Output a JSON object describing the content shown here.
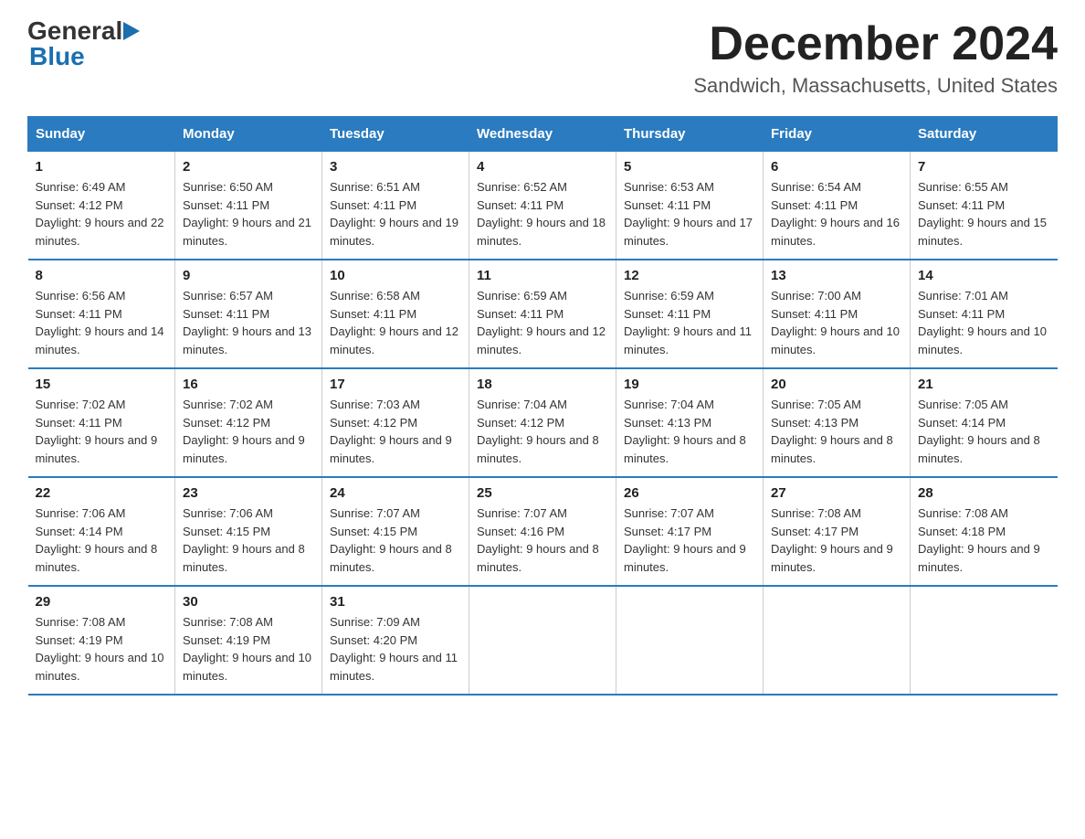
{
  "header": {
    "month_title": "December 2024",
    "location": "Sandwich, Massachusetts, United States"
  },
  "logo": {
    "general": "General",
    "blue": "Blue"
  },
  "days_of_week": [
    "Sunday",
    "Monday",
    "Tuesday",
    "Wednesday",
    "Thursday",
    "Friday",
    "Saturday"
  ],
  "weeks": [
    [
      {
        "day": "1",
        "sunrise": "6:49 AM",
        "sunset": "4:12 PM",
        "daylight": "9 hours and 22 minutes."
      },
      {
        "day": "2",
        "sunrise": "6:50 AM",
        "sunset": "4:11 PM",
        "daylight": "9 hours and 21 minutes."
      },
      {
        "day": "3",
        "sunrise": "6:51 AM",
        "sunset": "4:11 PM",
        "daylight": "9 hours and 19 minutes."
      },
      {
        "day": "4",
        "sunrise": "6:52 AM",
        "sunset": "4:11 PM",
        "daylight": "9 hours and 18 minutes."
      },
      {
        "day": "5",
        "sunrise": "6:53 AM",
        "sunset": "4:11 PM",
        "daylight": "9 hours and 17 minutes."
      },
      {
        "day": "6",
        "sunrise": "6:54 AM",
        "sunset": "4:11 PM",
        "daylight": "9 hours and 16 minutes."
      },
      {
        "day": "7",
        "sunrise": "6:55 AM",
        "sunset": "4:11 PM",
        "daylight": "9 hours and 15 minutes."
      }
    ],
    [
      {
        "day": "8",
        "sunrise": "6:56 AM",
        "sunset": "4:11 PM",
        "daylight": "9 hours and 14 minutes."
      },
      {
        "day": "9",
        "sunrise": "6:57 AM",
        "sunset": "4:11 PM",
        "daylight": "9 hours and 13 minutes."
      },
      {
        "day": "10",
        "sunrise": "6:58 AM",
        "sunset": "4:11 PM",
        "daylight": "9 hours and 12 minutes."
      },
      {
        "day": "11",
        "sunrise": "6:59 AM",
        "sunset": "4:11 PM",
        "daylight": "9 hours and 12 minutes."
      },
      {
        "day": "12",
        "sunrise": "6:59 AM",
        "sunset": "4:11 PM",
        "daylight": "9 hours and 11 minutes."
      },
      {
        "day": "13",
        "sunrise": "7:00 AM",
        "sunset": "4:11 PM",
        "daylight": "9 hours and 10 minutes."
      },
      {
        "day": "14",
        "sunrise": "7:01 AM",
        "sunset": "4:11 PM",
        "daylight": "9 hours and 10 minutes."
      }
    ],
    [
      {
        "day": "15",
        "sunrise": "7:02 AM",
        "sunset": "4:11 PM",
        "daylight": "9 hours and 9 minutes."
      },
      {
        "day": "16",
        "sunrise": "7:02 AM",
        "sunset": "4:12 PM",
        "daylight": "9 hours and 9 minutes."
      },
      {
        "day": "17",
        "sunrise": "7:03 AM",
        "sunset": "4:12 PM",
        "daylight": "9 hours and 9 minutes."
      },
      {
        "day": "18",
        "sunrise": "7:04 AM",
        "sunset": "4:12 PM",
        "daylight": "9 hours and 8 minutes."
      },
      {
        "day": "19",
        "sunrise": "7:04 AM",
        "sunset": "4:13 PM",
        "daylight": "9 hours and 8 minutes."
      },
      {
        "day": "20",
        "sunrise": "7:05 AM",
        "sunset": "4:13 PM",
        "daylight": "9 hours and 8 minutes."
      },
      {
        "day": "21",
        "sunrise": "7:05 AM",
        "sunset": "4:14 PM",
        "daylight": "9 hours and 8 minutes."
      }
    ],
    [
      {
        "day": "22",
        "sunrise": "7:06 AM",
        "sunset": "4:14 PM",
        "daylight": "9 hours and 8 minutes."
      },
      {
        "day": "23",
        "sunrise": "7:06 AM",
        "sunset": "4:15 PM",
        "daylight": "9 hours and 8 minutes."
      },
      {
        "day": "24",
        "sunrise": "7:07 AM",
        "sunset": "4:15 PM",
        "daylight": "9 hours and 8 minutes."
      },
      {
        "day": "25",
        "sunrise": "7:07 AM",
        "sunset": "4:16 PM",
        "daylight": "9 hours and 8 minutes."
      },
      {
        "day": "26",
        "sunrise": "7:07 AM",
        "sunset": "4:17 PM",
        "daylight": "9 hours and 9 minutes."
      },
      {
        "day": "27",
        "sunrise": "7:08 AM",
        "sunset": "4:17 PM",
        "daylight": "9 hours and 9 minutes."
      },
      {
        "day": "28",
        "sunrise": "7:08 AM",
        "sunset": "4:18 PM",
        "daylight": "9 hours and 9 minutes."
      }
    ],
    [
      {
        "day": "29",
        "sunrise": "7:08 AM",
        "sunset": "4:19 PM",
        "daylight": "9 hours and 10 minutes."
      },
      {
        "day": "30",
        "sunrise": "7:08 AM",
        "sunset": "4:19 PM",
        "daylight": "9 hours and 10 minutes."
      },
      {
        "day": "31",
        "sunrise": "7:09 AM",
        "sunset": "4:20 PM",
        "daylight": "9 hours and 11 minutes."
      },
      null,
      null,
      null,
      null
    ]
  ]
}
